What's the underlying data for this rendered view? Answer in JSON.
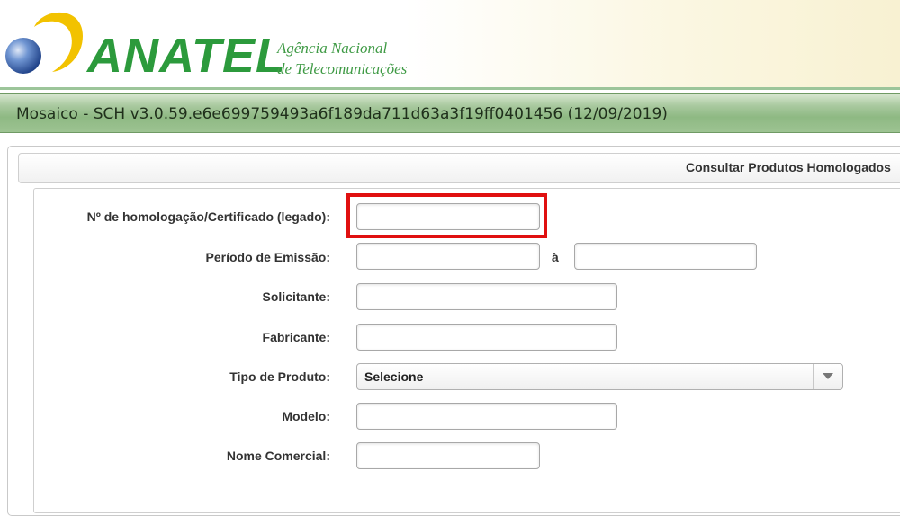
{
  "header": {
    "logo_text": "ANATEL",
    "agency_line1": "Agência Nacional",
    "agency_line2": "de Telecomunicações",
    "brand_green": "#2c9a3c",
    "brand_yellow": "#f2c200",
    "brand_blue": "#2f5fa8"
  },
  "version_bar": {
    "text": "Mosaico - SCH  v3.0.59.e6e699759493a6f189da711d63a3f19ff0401456 (12/09/2019)"
  },
  "panel": {
    "title": "Consultar Produtos Homologados"
  },
  "form": {
    "homologacao_label": "Nº de homologação/Certificado (legado):",
    "periodo_label": "Período de Emissão:",
    "periodo_separator": "à",
    "solicitante_label": "Solicitante:",
    "fabricante_label": "Fabricante:",
    "tipo_produto_label": "Tipo de Produto:",
    "tipo_produto_value": "Selecione",
    "modelo_label": "Modelo:",
    "nome_comercial_label": "Nome Comercial:",
    "highlight_color": "#e01010"
  }
}
